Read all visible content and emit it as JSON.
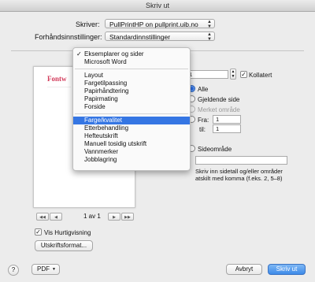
{
  "window": {
    "title": "Skriv ut"
  },
  "printer": {
    "label": "Skriver:",
    "value": "PullPrintHP on pullprint.uib.no"
  },
  "presets": {
    "label": "Forhåndsinnstillinger:",
    "value": "Standardinnstillinger"
  },
  "preview": {
    "doc_title": "Fontw",
    "page_indicator": "1 av 1",
    "nav": [
      "◀◀",
      "◀",
      "▶",
      "▶▶"
    ],
    "quick_preview_label": "Vis Hurtigvisning",
    "page_setup_button": "Utskriftsformat..."
  },
  "copies": {
    "value": "1",
    "collated_label": "Kollatert"
  },
  "pages": {
    "all": "Alle",
    "current": "Gjeldende side",
    "selection": "Merket område",
    "from_label": "Fra:",
    "from_value": "1",
    "to_label": "til:",
    "to_value": "1",
    "range_label": "Sideområde",
    "range_help": "Skriv inn sidetall og/eller områder atskilt med komma (f.eks. 2, 5–8)"
  },
  "menu": {
    "items": [
      {
        "label": "Eksemplarer og sider",
        "checked": true
      },
      {
        "label": "Microsoft Word"
      },
      {
        "separator": true
      },
      {
        "label": "Layout"
      },
      {
        "label": "Fargetilpassing"
      },
      {
        "label": "Papirhåndtering"
      },
      {
        "label": "Papirmating"
      },
      {
        "label": "Forside"
      },
      {
        "separator": true
      },
      {
        "label": "Farge/kvalitet",
        "highlighted": true
      },
      {
        "label": "Etterbehandling"
      },
      {
        "label": "Hefteutskrift"
      },
      {
        "label": "Manuell tosidig utskrift"
      },
      {
        "label": "Vannmerker"
      },
      {
        "label": "Jobblagring"
      }
    ]
  },
  "footer": {
    "help": "?",
    "pdf_label": "PDF",
    "cancel": "Avbryt",
    "print": "Skriv ut"
  },
  "colors": {
    "accent": "#3576e3",
    "doc_title": "#d23a5a"
  }
}
